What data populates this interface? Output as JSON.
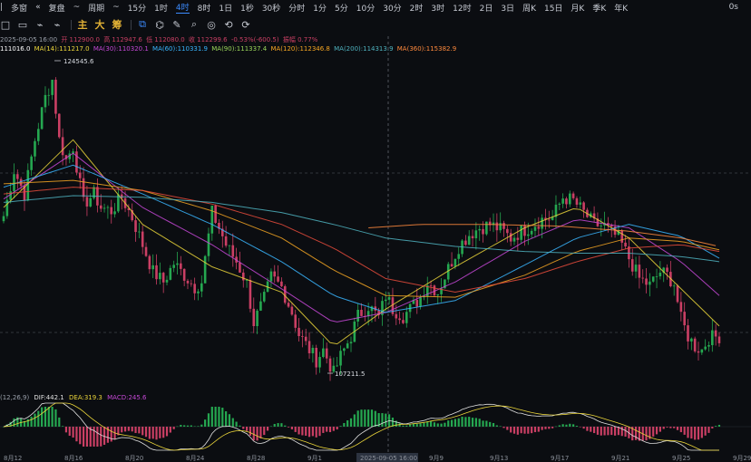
{
  "toolbar": {
    "items": [
      "|",
      "多窗",
      "«",
      "复盘",
      "~",
      "周期",
      "~",
      "15分",
      "1时",
      "4时",
      "8时",
      "1日",
      "1秒",
      "30秒",
      "分时",
      "1分",
      "5分",
      "10分",
      "30分",
      "2时",
      "3时",
      "12时",
      "2日",
      "3日",
      "周K",
      "15日",
      "月K",
      "季K",
      "年K"
    ],
    "active": "4时",
    "right_label": "0s"
  },
  "tools": {
    "items": [
      "□",
      "▭",
      "⌁",
      "⌁",
      "主",
      "大",
      "筹",
      "⧉",
      "⌬",
      "✎",
      "⌕",
      "◎",
      "⟲",
      "⟳"
    ]
  },
  "info": {
    "time": "2025-09-05 16:00",
    "open": "开 112900.0",
    "high": "高 112947.6",
    "low": "低 112080.0",
    "close": "收 112299.6",
    "change": "-0.53%(-600.5)",
    "amp": "振幅 0.77%"
  },
  "ma": {
    "ma7": "111016.0",
    "ma14": "MA(14):111217.0",
    "ma30": "MA(30):110320.1",
    "ma60": "MA(60):110331.9",
    "ma90": "MA(90):111337.4",
    "ma120": "MA(120):112346.8",
    "ma200": "MA(200):114313.9",
    "ma360": "MA(360):115382.9"
  },
  "macd": {
    "params": "(12,26,9)",
    "dif": "DIF:442.1",
    "dea": "DEA:319.3",
    "macd": "MACD:245.6"
  },
  "annotations": {
    "high": "124545.6",
    "low": "107211.5"
  },
  "cursor": {
    "time_label": "2025-09-05 16:00"
  },
  "colors": {
    "up": "#25a750",
    "down": "#ca3f64",
    "ma14": "#e9d43a",
    "ma30": "#c548d6",
    "ma60": "#39b6ff",
    "ma90": "#f5a623",
    "ma120": "#e74c3c",
    "ma200": "#4fb3bf",
    "ma360": "#ff8a3d"
  },
  "chart_data": {
    "type": "candlestick",
    "interval": "4时",
    "x_ticks": [
      "8月12",
      "8月16",
      "8月20",
      "8月24",
      "8月28",
      "9月1",
      "9月5",
      "9月9",
      "9月13",
      "9月17",
      "9月21",
      "9月25",
      "9月29"
    ],
    "y_range": [
      106500,
      125300
    ],
    "high_point": 124545.6,
    "low_point": 107211.5,
    "macd_range": [
      -1400,
      1300
    ],
    "path_points": [
      [
        0,
        116500
      ],
      [
        3,
        119200
      ],
      [
        6,
        117800
      ],
      [
        9,
        121000
      ],
      [
        12,
        123500
      ],
      [
        14,
        124545.6
      ],
      [
        16,
        121000
      ],
      [
        18,
        119800
      ],
      [
        20,
        120600
      ],
      [
        23,
        117200
      ],
      [
        26,
        117800
      ],
      [
        28,
        117000
      ],
      [
        31,
        116800
      ],
      [
        34,
        117600
      ],
      [
        37,
        116400
      ],
      [
        40,
        114800
      ],
      [
        43,
        113200
      ],
      [
        46,
        112600
      ],
      [
        49,
        113700
      ],
      [
        52,
        113000
      ],
      [
        55,
        112300
      ],
      [
        57,
        112600
      ],
      [
        60,
        116700
      ],
      [
        62,
        115800
      ],
      [
        64,
        114800
      ],
      [
        67,
        113800
      ],
      [
        70,
        112500
      ],
      [
        72,
        110200
      ],
      [
        75,
        111600
      ],
      [
        77,
        112900
      ],
      [
        80,
        112300
      ],
      [
        83,
        110800
      ],
      [
        85,
        109500
      ],
      [
        88,
        108600
      ],
      [
        90,
        108000
      ],
      [
        92,
        108600
      ],
      [
        95,
        107211.5
      ],
      [
        97,
        108200
      ],
      [
        100,
        109400
      ],
      [
        102,
        110600
      ],
      [
        105,
        111200
      ],
      [
        108,
        110500
      ],
      [
        110,
        111800
      ],
      [
        112,
        111000
      ],
      [
        115,
        110600
      ],
      [
        117,
        111000
      ],
      [
        120,
        111700
      ],
      [
        122,
        112600
      ],
      [
        125,
        112000
      ],
      [
        128,
        113400
      ],
      [
        131,
        114700
      ],
      [
        134,
        115400
      ],
      [
        137,
        115800
      ],
      [
        140,
        116000
      ],
      [
        143,
        115700
      ],
      [
        146,
        115200
      ],
      [
        149,
        115600
      ],
      [
        152,
        115900
      ],
      [
        155,
        116300
      ],
      [
        158,
        116400
      ],
      [
        161,
        117600
      ],
      [
        164,
        117400
      ],
      [
        167,
        116700
      ],
      [
        170,
        116000
      ],
      [
        173,
        115900
      ],
      [
        175,
        115500
      ],
      [
        177,
        115200
      ],
      [
        179,
        114400
      ],
      [
        181,
        113600
      ],
      [
        183,
        112800
      ],
      [
        186,
        112400
      ],
      [
        189,
        113200
      ],
      [
        191,
        113000
      ],
      [
        193,
        112500
      ],
      [
        195,
        110400
      ],
      [
        197,
        109400
      ],
      [
        199,
        108800
      ],
      [
        201,
        108600
      ],
      [
        203,
        109300
      ],
      [
        206,
        109400
      ]
    ],
    "ma_lines": {
      "ma14": [
        [
          0,
          117000
        ],
        [
          20,
          121000
        ],
        [
          40,
          116000
        ],
        [
          60,
          113500
        ],
        [
          80,
          112000
        ],
        [
          95,
          108800
        ],
        [
          110,
          111000
        ],
        [
          130,
          113500
        ],
        [
          150,
          115800
        ],
        [
          165,
          117000
        ],
        [
          180,
          115200
        ],
        [
          195,
          112200
        ],
        [
          206,
          110000
        ]
      ],
      "ma30": [
        [
          0,
          117500
        ],
        [
          20,
          120200
        ],
        [
          40,
          117000
        ],
        [
          60,
          114800
        ],
        [
          80,
          112200
        ],
        [
          95,
          110200
        ],
        [
          110,
          110800
        ],
        [
          130,
          112600
        ],
        [
          150,
          115000
        ],
        [
          165,
          116300
        ],
        [
          180,
          115800
        ],
        [
          195,
          113800
        ],
        [
          206,
          111800
        ]
      ],
      "ma60": [
        [
          0,
          118200
        ],
        [
          20,
          119500
        ],
        [
          40,
          117800
        ],
        [
          60,
          116000
        ],
        [
          80,
          113800
        ],
        [
          95,
          111800
        ],
        [
          110,
          110800
        ],
        [
          130,
          111500
        ],
        [
          150,
          113600
        ],
        [
          165,
          115200
        ],
        [
          180,
          116000
        ],
        [
          195,
          115300
        ],
        [
          206,
          114000
        ]
      ],
      "ma90": [
        [
          0,
          118400
        ],
        [
          20,
          118600
        ],
        [
          40,
          118000
        ],
        [
          60,
          116800
        ],
        [
          80,
          115200
        ],
        [
          95,
          113300
        ],
        [
          110,
          111800
        ],
        [
          130,
          111700
        ],
        [
          150,
          113000
        ],
        [
          165,
          114400
        ],
        [
          180,
          115200
        ],
        [
          195,
          115000
        ],
        [
          206,
          114500
        ]
      ],
      "ma120": [
        [
          0,
          117800
        ],
        [
          20,
          118200
        ],
        [
          40,
          118000
        ],
        [
          60,
          117200
        ],
        [
          80,
          116000
        ],
        [
          95,
          114600
        ],
        [
          110,
          112800
        ],
        [
          130,
          112000
        ],
        [
          150,
          112800
        ],
        [
          165,
          113800
        ],
        [
          180,
          114600
        ],
        [
          195,
          114800
        ],
        [
          206,
          114400
        ]
      ],
      "ma200": [
        [
          0,
          117300
        ],
        [
          20,
          117700
        ],
        [
          40,
          117600
        ],
        [
          60,
          117300
        ],
        [
          80,
          116700
        ],
        [
          95,
          116000
        ],
        [
          110,
          115200
        ],
        [
          130,
          114700
        ],
        [
          150,
          114400
        ],
        [
          165,
          114300
        ],
        [
          180,
          114300
        ],
        [
          195,
          114100
        ],
        [
          206,
          113800
        ]
      ],
      "ma360": [
        [
          105,
          115800
        ],
        [
          120,
          116000
        ],
        [
          140,
          116000
        ],
        [
          160,
          115900
        ],
        [
          180,
          115600
        ],
        [
          195,
          115200
        ],
        [
          206,
          114700
        ]
      ]
    }
  }
}
